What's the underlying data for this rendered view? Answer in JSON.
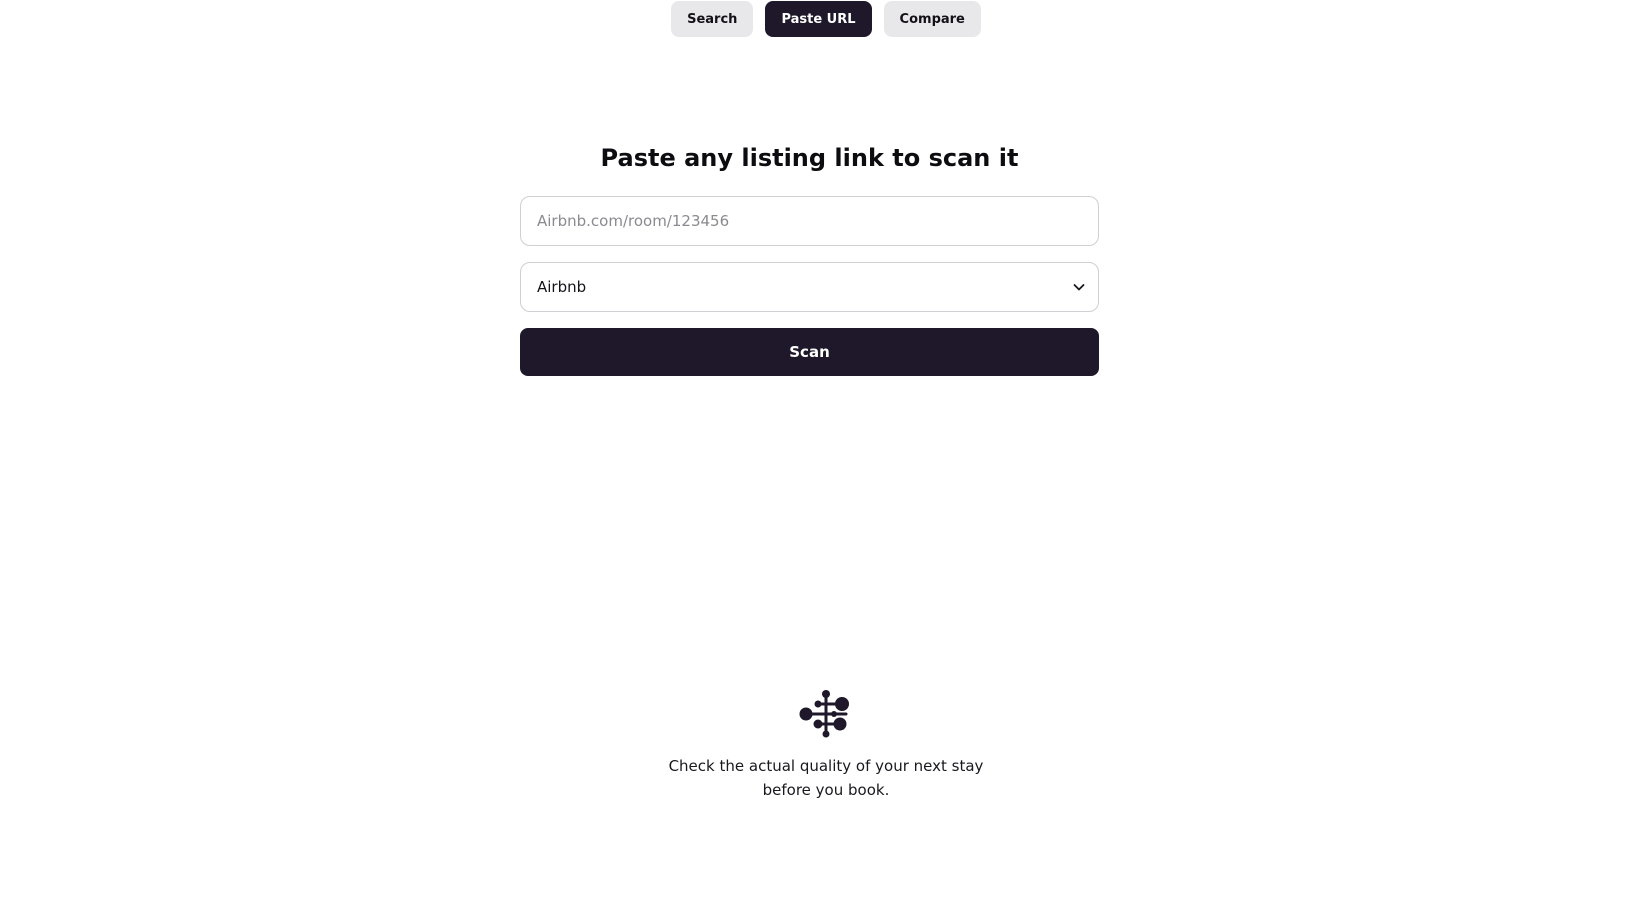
{
  "tabs": [
    {
      "label": "Search",
      "active": false
    },
    {
      "label": "Paste URL",
      "active": true
    },
    {
      "label": "Compare",
      "active": false
    }
  ],
  "form": {
    "heading": "Paste any listing link to scan it",
    "url_placeholder": "Airbnb.com/room/123456",
    "url_value": "",
    "platform_selected": "Airbnb",
    "scan_label": "Scan"
  },
  "footer": {
    "logo_icon": "molecule-logo-icon",
    "tagline_line1": "Check the actual quality of your next stay",
    "tagline_line2": "before you book."
  },
  "colors": {
    "primary": "#1e182a",
    "tab_inactive": "#e8e8ea",
    "background": "#ffffff"
  }
}
